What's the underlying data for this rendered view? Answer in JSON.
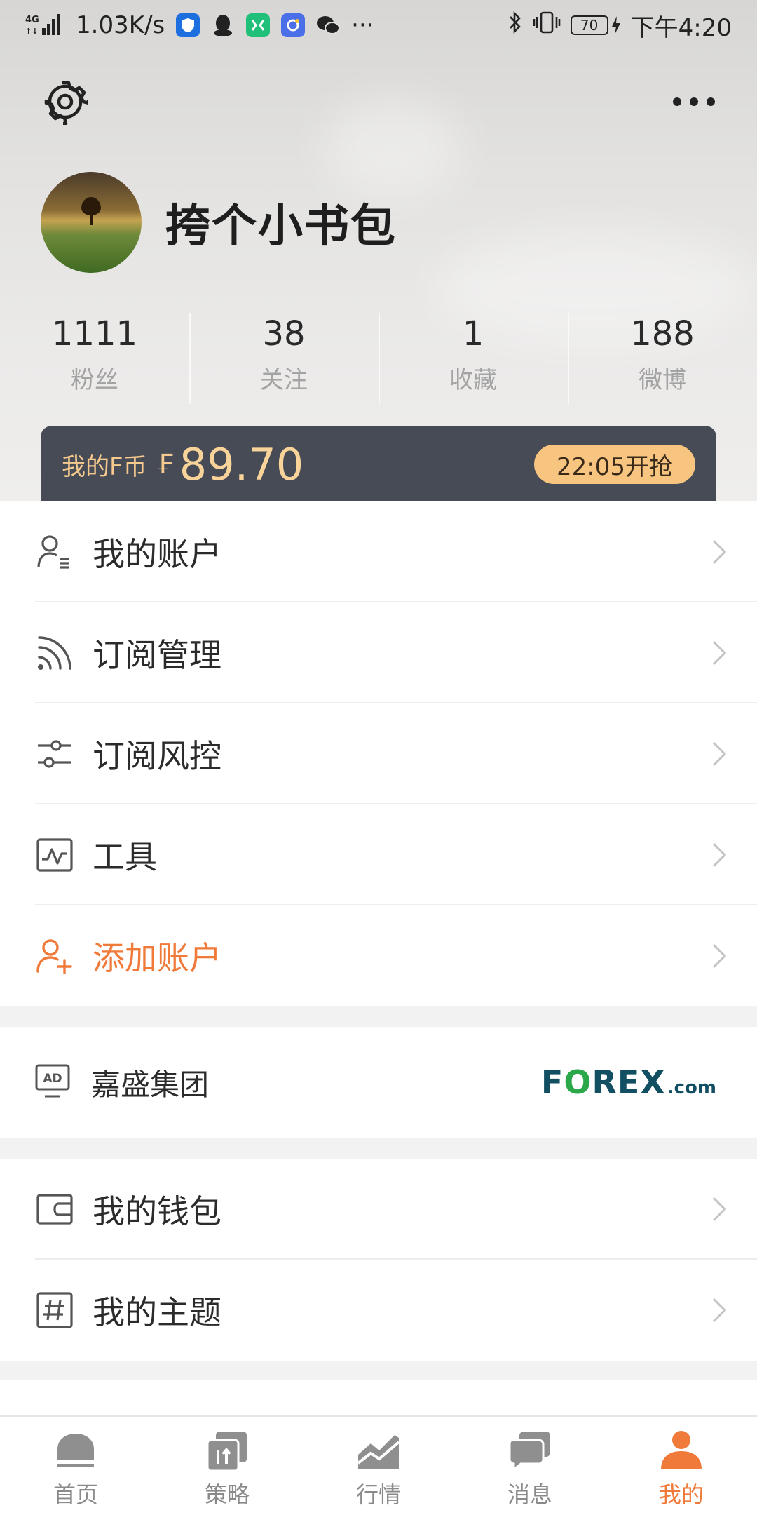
{
  "status_bar": {
    "network": "4G",
    "speed": "1.03K/s",
    "more": "···",
    "battery": "70",
    "time": "下午4:20"
  },
  "profile": {
    "username": "挎个小书包"
  },
  "stats": [
    {
      "value": "1111",
      "label": "粉丝"
    },
    {
      "value": "38",
      "label": "关注"
    },
    {
      "value": "1",
      "label": "收藏"
    },
    {
      "value": "188",
      "label": "微博"
    }
  ],
  "fcoin": {
    "label": "我的F币",
    "symbol": "₣",
    "value": "89.70",
    "button": "22:05开抢"
  },
  "menu": [
    {
      "label": "我的账户",
      "icon": "account-icon"
    },
    {
      "label": "订阅管理",
      "icon": "rss-icon"
    },
    {
      "label": "订阅风控",
      "icon": "sliders-icon"
    },
    {
      "label": "工具",
      "icon": "chart-tool-icon"
    },
    {
      "label": "添加账户",
      "icon": "add-user-icon"
    }
  ],
  "ad": {
    "label": "嘉盛集团",
    "badge": "AD",
    "brand_main": "FOREX",
    "brand_suffix": ".com"
  },
  "menu2": [
    {
      "label": "我的钱包",
      "icon": "wallet-icon"
    },
    {
      "label": "我的主题",
      "icon": "hashtag-icon"
    }
  ],
  "tabs": [
    {
      "label": "首页",
      "icon": "home-icon"
    },
    {
      "label": "策略",
      "icon": "strategy-icon"
    },
    {
      "label": "行情",
      "icon": "market-icon"
    },
    {
      "label": "消息",
      "icon": "message-icon"
    },
    {
      "label": "我的",
      "icon": "profile-icon",
      "active": true
    }
  ],
  "colors": {
    "accent": "#f07a3a",
    "fcoin_bg": "#464b56",
    "fcoin_text": "#f6c98e"
  }
}
